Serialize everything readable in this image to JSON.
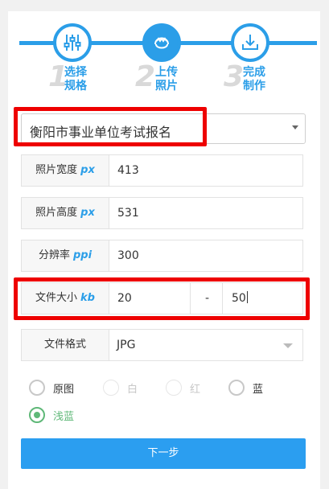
{
  "steps": [
    {
      "num": "1",
      "line1": "选择",
      "line2": "规格",
      "icon": "sliders-icon"
    },
    {
      "num": "2",
      "line1": "上传",
      "line2": "照片",
      "icon": "portrait-icon"
    },
    {
      "num": "3",
      "line1": "完成",
      "line2": "制作",
      "icon": "download-icon"
    }
  ],
  "spec_select": {
    "value": "衡阳市事业单位考试报名"
  },
  "fields": {
    "width": {
      "label": "照片宽度",
      "unit": "px",
      "value": "413"
    },
    "height": {
      "label": "照片高度",
      "unit": "px",
      "value": "531"
    },
    "dpi": {
      "label": "分辨率",
      "unit": "ppi",
      "value": "300"
    },
    "filesize": {
      "label": "文件大小",
      "unit": "kb",
      "min": "20",
      "separator": "-",
      "max": "50"
    },
    "format": {
      "label": "文件格式",
      "value": "JPG"
    }
  },
  "background_options": [
    {
      "label": "原图",
      "state": "enabled"
    },
    {
      "label": "白",
      "state": "disabled"
    },
    {
      "label": "红",
      "state": "disabled"
    },
    {
      "label": "蓝",
      "state": "enabled"
    },
    {
      "label": "浅蓝",
      "state": "selected"
    }
  ],
  "next_button": {
    "label": "下一步"
  },
  "colors": {
    "accent": "#2b9ee8",
    "highlight": "#ee0000",
    "selected": "#5fb878"
  }
}
